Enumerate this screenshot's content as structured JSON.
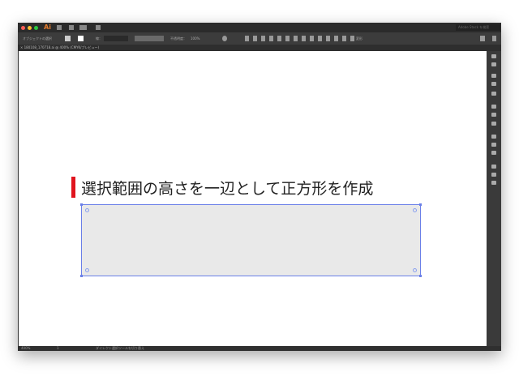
{
  "app": {
    "logo": "Ai",
    "search_placeholder": "Adobe Stock を検索"
  },
  "control_bar": {
    "selection_label": "オブジェクトの選択",
    "stroke_label": "線：",
    "opacity_label": "不透明度：",
    "opacity_value": "100%",
    "transform_label": "変形"
  },
  "document_tab": {
    "title": "180108_170718.ai @ 400% (CMYK/プレビュー)"
  },
  "artboard": {
    "heading": "選択範囲の高さを一辺として正方形を作成"
  },
  "status_bar": {
    "zoom": "400%",
    "page": "1",
    "tool_hint": "ダイレクト選択ツールを切り替え"
  },
  "colors": {
    "accent_red": "#e0141e",
    "selection_blue": "#6a7fe8",
    "shape_fill": "#e9e9e9"
  }
}
